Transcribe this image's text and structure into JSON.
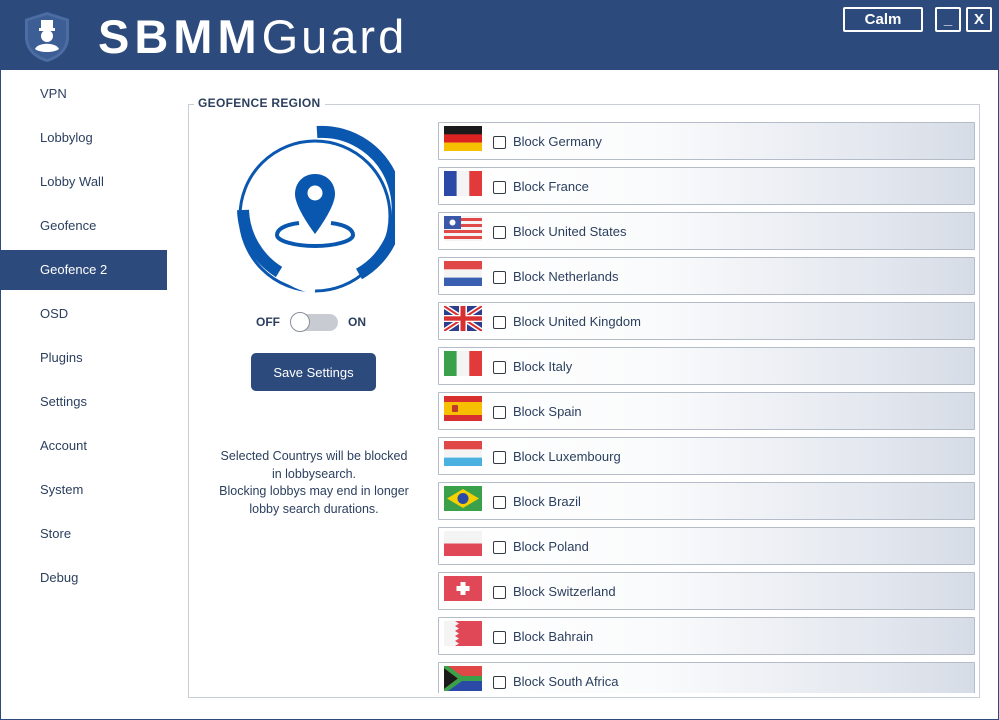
{
  "app": {
    "brand_bold": "SBMM",
    "brand_light": "Guard",
    "mode_button": "Calm",
    "minimize": "_",
    "close": "X"
  },
  "sidebar": {
    "items": [
      {
        "label": "VPN"
      },
      {
        "label": "Lobbylog"
      },
      {
        "label": "Lobby Wall"
      },
      {
        "label": "Geofence"
      },
      {
        "label": "Geofence 2",
        "active": true
      },
      {
        "label": "OSD"
      },
      {
        "label": "Plugins"
      },
      {
        "label": "Settings"
      },
      {
        "label": "Account"
      },
      {
        "label": "System"
      },
      {
        "label": "Store"
      },
      {
        "label": "Debug"
      }
    ]
  },
  "geofence": {
    "title": "GEOFENCE REGION",
    "icon": "location-pin-icon",
    "toggle_off": "OFF",
    "toggle_on": "ON",
    "toggle_state": "off",
    "save_button": "Save Settings",
    "note_line1": "Selected Countrys will be blocked",
    "note_line2": "in lobbysearch.",
    "note_line3": "Blocking lobbys may end in longer",
    "note_line4": "lobby search durations."
  },
  "countries": [
    {
      "label": "Block Germany",
      "flag": "germany-flag-icon",
      "checked": false
    },
    {
      "label": "Block France",
      "flag": "france-flag-icon",
      "checked": false
    },
    {
      "label": "Block United States",
      "flag": "united-states-flag-icon",
      "checked": false
    },
    {
      "label": "Block Netherlands",
      "flag": "netherlands-flag-icon",
      "checked": false
    },
    {
      "label": "Block United Kingdom",
      "flag": "united-kingdom-flag-icon",
      "checked": false
    },
    {
      "label": "Block Italy",
      "flag": "italy-flag-icon",
      "checked": false
    },
    {
      "label": "Block Spain",
      "flag": "spain-flag-icon",
      "checked": false
    },
    {
      "label": "Block Luxembourg",
      "flag": "luxembourg-flag-icon",
      "checked": false
    },
    {
      "label": "Block Brazil",
      "flag": "brazil-flag-icon",
      "checked": false
    },
    {
      "label": "Block Poland",
      "flag": "poland-flag-icon",
      "checked": false
    },
    {
      "label": "Block Switzerland",
      "flag": "switzerland-flag-icon",
      "checked": false
    },
    {
      "label": "Block Bahrain",
      "flag": "bahrain-flag-icon",
      "checked": false
    },
    {
      "label": "Block South Africa",
      "flag": "south-africa-flag-icon",
      "checked": false
    }
  ],
  "colors": {
    "primary": "#2d4a7c",
    "accent_blue": "#0a57b0",
    "text": "#2b3f5e"
  }
}
